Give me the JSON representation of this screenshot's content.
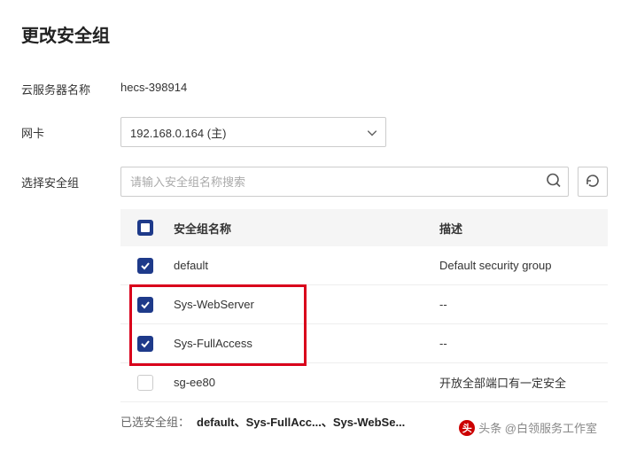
{
  "title": "更改安全组",
  "server_name_label": "云服务器名称",
  "server_name_value": "hecs-398914",
  "nic_label": "网卡",
  "nic_selected": "192.168.0.164 (主)",
  "select_sg_label": "选择安全组",
  "search_placeholder": "请输入安全组名称搜索",
  "table": {
    "header_name": "安全组名称",
    "header_desc": "描述",
    "rows": [
      {
        "name": "default",
        "desc": "Default security group",
        "checked": true
      },
      {
        "name": "Sys-WebServer",
        "desc": "--",
        "checked": true
      },
      {
        "name": "Sys-FullAccess",
        "desc": "--",
        "checked": true
      },
      {
        "name": "sg-ee80",
        "desc": "开放全部端口有一定安全",
        "checked": false
      }
    ]
  },
  "selected_label": "已选安全组：",
  "selected_items": "default、Sys-FullAcc...、Sys-WebSe...",
  "watermark": "头条 @白领服务工作室"
}
